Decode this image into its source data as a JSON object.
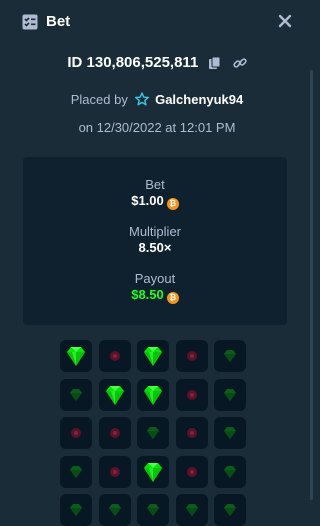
{
  "header": {
    "title": "Bet",
    "icon": "bet-list-icon",
    "close_icon": "close-icon"
  },
  "bet": {
    "id": "ID 130,806,525,811",
    "copy_icon": "copy-icon",
    "link_icon": "link-icon",
    "placed_by_prefix": "Placed by",
    "user": "Galchenyuk94",
    "user_icon": "star-icon",
    "date": "on 12/30/2022 at 12:01 PM"
  },
  "stats": {
    "bet_label": "Bet",
    "bet_value": "$1.00",
    "multiplier_label": "Multiplier",
    "multiplier_value": "8.50×",
    "payout_label": "Payout",
    "payout_value": "$8.50",
    "currency_icon": "bitcoin-icon",
    "currency_symbol": "₿"
  },
  "colors": {
    "background": "#1a2c38",
    "panel": "#0f212e",
    "accent_green": "#1fff20",
    "muted_text": "#b1bad3",
    "coin": "#f7931a"
  },
  "mines_grid": {
    "rows": [
      [
        "gem-revealed",
        "mine",
        "gem-revealed",
        "mine",
        "gem"
      ],
      [
        "gem",
        "gem-revealed",
        "gem-revealed",
        "mine",
        "gem"
      ],
      [
        "mine",
        "mine",
        "gem",
        "mine",
        "gem"
      ],
      [
        "gem",
        "mine",
        "gem-revealed",
        "mine",
        "gem"
      ],
      [
        "gem",
        "gem",
        "gem",
        "gem",
        "gem"
      ]
    ]
  }
}
